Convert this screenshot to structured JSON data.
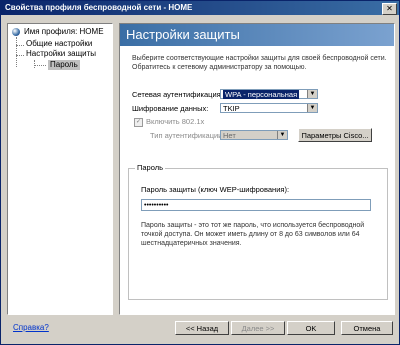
{
  "window": {
    "title": "Свойства профиля беспроводной сети - HOME",
    "close_label": "✕"
  },
  "tree": {
    "items": [
      {
        "label": "Имя профиля: HOME"
      },
      {
        "label": "Общие настройки"
      },
      {
        "label": "Настройки защиты"
      },
      {
        "label": "Пароль"
      }
    ]
  },
  "panel": {
    "header": "Настройки защиты",
    "description": "Выберите соответствующие настройки защиты для своей беспроводной сети. Обратитесь к сетевому администратору за помощью.",
    "auth": {
      "label": "Сетевая аутентификация:",
      "value": "WPA - персональная"
    },
    "encryption": {
      "label": "Шифрование данных:",
      "value": "TKIP"
    },
    "ieee8021x": {
      "label": "Включить 802.1x"
    },
    "auth_type": {
      "label": "Тип аутентификации:",
      "value": "Нет"
    },
    "cisco_button": "Параметры Cisco...",
    "password_group": {
      "title": "Пароль",
      "field_label": "Пароль защиты (ключ WEP-шифрования):",
      "value": "••••••••••",
      "note": "Пароль защиты - это тот же пароль, что используется беспроводной точкой доступа. Он может иметь длину от 8 до 63 символов или 64 шестнадцатеричных значения."
    }
  },
  "footer": {
    "help": "Справка?",
    "back": "<< Назад",
    "next": "Далее >>",
    "ok": "OK",
    "cancel": "Отмена"
  },
  "colors": {
    "title_bar": "#0a246a",
    "header_gradient_start": "#3a6ea5",
    "selection": "#0a246a"
  }
}
